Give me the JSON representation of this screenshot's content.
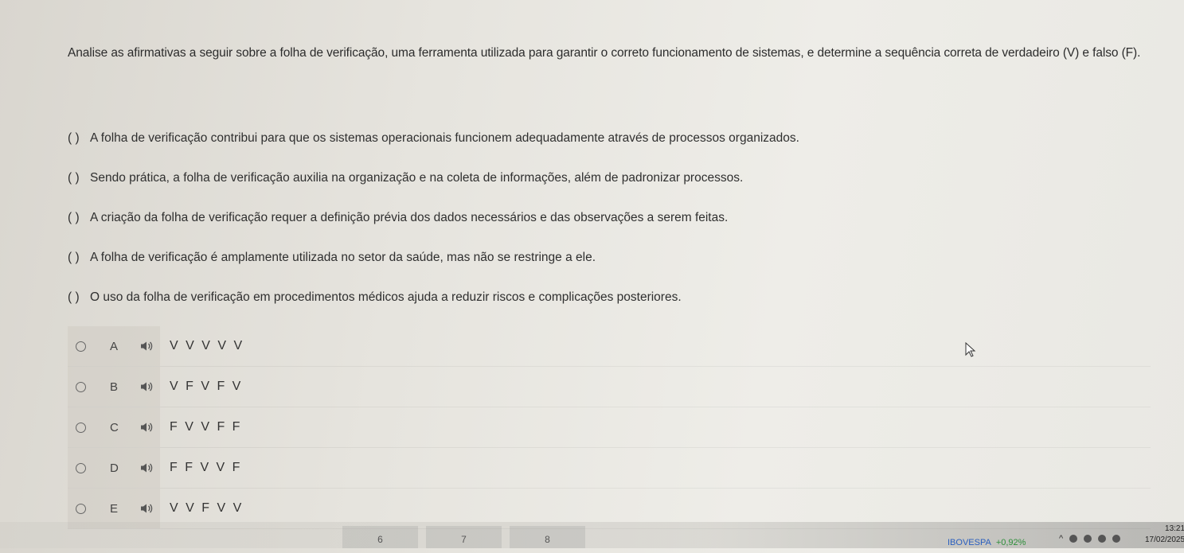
{
  "question": "Analise as afirmativas a seguir sobre a folha de verificação, uma ferramenta utilizada para garantir o correto funcionamento de sistemas, e determine a sequência correta de verdadeiro (V) e falso (F).",
  "statements": [
    {
      "paren": "(  )",
      "text": "A folha de verificação contribui para que os sistemas operacionais funcionem adequadamente através de processos organizados."
    },
    {
      "paren": "(  )",
      "text": "Sendo prática, a folha de verificação auxilia na organização e na coleta de informações, além de padronizar processos."
    },
    {
      "paren": "(  )",
      "text": "A criação da folha de verificação requer a definição prévia dos dados necessários e das observações a serem feitas."
    },
    {
      "paren": "(  )",
      "text": "A folha de verificação é amplamente utilizada no setor da saúde, mas não se restringe a ele."
    },
    {
      "paren": "(  )",
      "text": "O uso da folha de verificação em procedimentos médicos ajuda a reduzir riscos e complicações posteriores."
    }
  ],
  "options": [
    {
      "letter": "A",
      "text": "V V V V V",
      "icon": "speaker-icon"
    },
    {
      "letter": "B",
      "text": "V F V F V",
      "icon": "speaker-icon"
    },
    {
      "letter": "C",
      "text": "F V V F F",
      "icon": "speaker-icon"
    },
    {
      "letter": "D",
      "text": "F F V V F",
      "icon": "speaker-icon"
    },
    {
      "letter": "E",
      "text": "V V F V V",
      "icon": "speaker-icon"
    }
  ],
  "taskbar": {
    "tab_numbers": [
      "6",
      "7",
      "8"
    ],
    "ticker_name": "IBOVESPA",
    "ticker_change": "+0,92%",
    "time": "13:21",
    "date": "17/02/2025"
  },
  "colors": {
    "text": "#2e2e2e",
    "ticker_up": "#2e8f3a",
    "ticker_name": "#2a5fbf"
  }
}
